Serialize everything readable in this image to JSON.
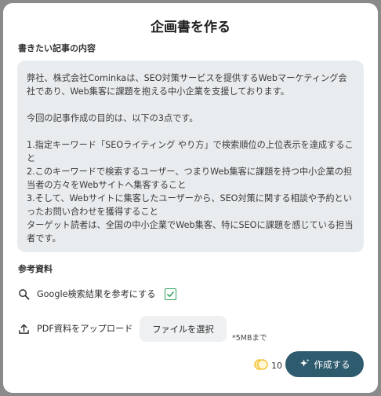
{
  "dialog": {
    "title": "企画書を作る",
    "content_label": "書きたい記事の内容",
    "content_text": "弊社、株式会社Cominkaは、SEO対策サービスを提供するWebマーケティング会社であり、Web集客に課題を抱える中小企業を支援しております。\n\n今回の記事作成の目的は、以下の3点です。\n\n1.指定キーワード「SEOライティング やり方」で検索順位の上位表示を達成すること\n2.このキーワードで検索するユーザー、つまりWeb集客に課題を持つ中小企業の担当者の方々をWebサイトへ集客すること\n3.そして、Webサイトに集客したユーザーから、SEO対策に関する相談や予約といったお問い合わせを獲得すること\nターゲット読者は、全国の中小企業でWeb集客、特にSEOに課題を感じている担当者です。",
    "references_label": "参考資料",
    "google_option_label": "Google検索結果を参考にする",
    "google_option_checked": true,
    "pdf_upload_label": "PDF資料をアップロード",
    "file_select_label": "ファイルを選択",
    "file_size_note": "*5MBまで",
    "credit_count": "10",
    "create_button_label": "作成する"
  },
  "colors": {
    "accent": "#2f5b6e",
    "checkbox": "#2e9e5b",
    "content_background": "#e9ecee",
    "coin": "#f2c230"
  },
  "icons": {
    "search": "search-icon",
    "upload": "upload-icon",
    "coin": "coin-icon",
    "sparkle": "sparkle-icon",
    "check": "check-icon"
  }
}
